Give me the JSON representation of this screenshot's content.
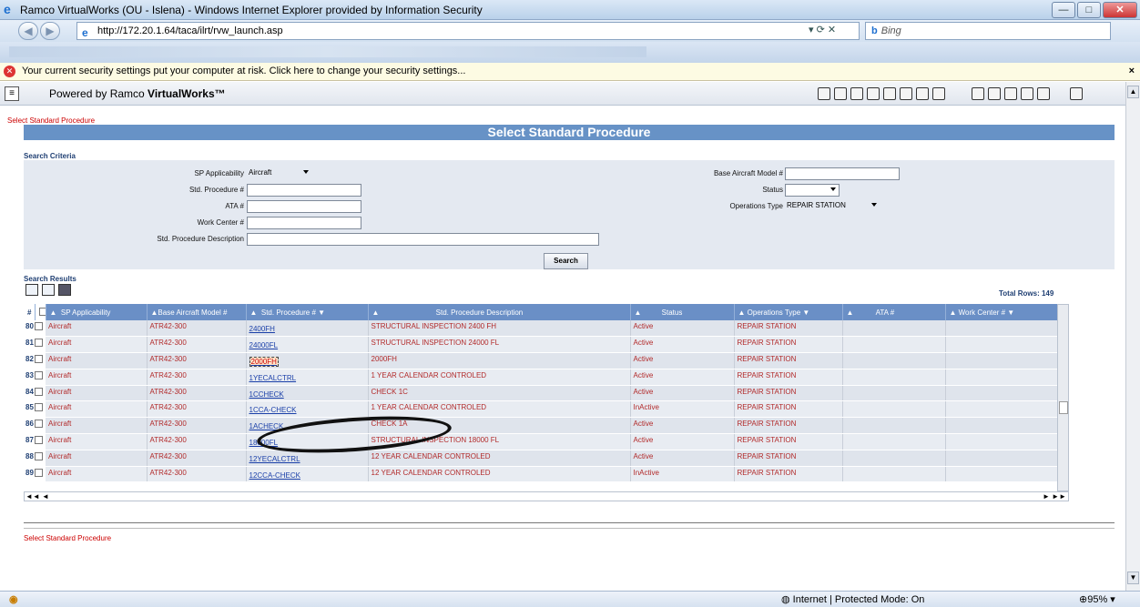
{
  "window": {
    "title": "Ramco VirtualWorks (OU - Islena) - Windows Internet Explorer provided by Information Security"
  },
  "browser": {
    "url": "http://172.20.1.64/taca/ilrt/rvw_launch.asp",
    "search_placeholder": "Bing",
    "security_message": "Your current security settings put your computer at risk. Click here to change your security settings...",
    "status_zone": "Internet | Protected Mode: On",
    "zoom": "95%"
  },
  "app": {
    "powered_by_prefix": "Powered by Ramco ",
    "powered_by_brand": "VirtualWorks™"
  },
  "page": {
    "breadcrumb": "Select Standard Procedure",
    "title": "Select Standard Procedure",
    "footer_breadcrumb": "Select Standard Procedure"
  },
  "criteria": {
    "section_label": "Search Criteria",
    "sp_applicability_label": "SP Applicability",
    "sp_applicability_value": "Aircraft",
    "std_procedure_label": "Std. Procedure #",
    "std_procedure_value": "",
    "ata_label": "ATA #",
    "ata_value": "",
    "work_center_label": "Work Center #",
    "work_center_value": "",
    "description_label": "Std. Procedure Description",
    "description_value": "",
    "base_model_label": "Base Aircraft Model #",
    "base_model_value": "",
    "status_label": "Status",
    "status_value": "",
    "ops_type_label": "Operations Type",
    "ops_type_value": "REPAIR STATION",
    "search_button": "Search"
  },
  "results": {
    "section_label": "Search Results",
    "total_rows": "Total Rows:  149",
    "columns": [
      "#",
      "SP Applicability",
      "Base Aircraft Model #",
      "Std. Procedure #",
      "Std. Procedure Description",
      "Status",
      "Operations Type",
      "ATA #",
      "Work Center #"
    ],
    "rows": [
      {
        "n": "80",
        "app": "Aircraft",
        "model": "ATR42-300",
        "proc": "2400FH",
        "desc": "STRUCTURAL INSPECTION 2400 FH",
        "status": "Active",
        "ops": "REPAIR STATION",
        "ata": "",
        "wc": ""
      },
      {
        "n": "81",
        "app": "Aircraft",
        "model": "ATR42-300",
        "proc": "24000FL",
        "desc": "STRUCTURAL INSPECTION 24000 FL",
        "status": "Active",
        "ops": "REPAIR STATION",
        "ata": "",
        "wc": ""
      },
      {
        "n": "82",
        "app": "Aircraft",
        "model": "ATR42-300",
        "proc": "2000FH",
        "desc": "2000FH",
        "status": "Active",
        "ops": "REPAIR STATION",
        "ata": "",
        "wc": ""
      },
      {
        "n": "83",
        "app": "Aircraft",
        "model": "ATR42-300",
        "proc": "1YECALCTRL",
        "desc": "1 YEAR CALENDAR CONTROLED",
        "status": "Active",
        "ops": "REPAIR STATION",
        "ata": "",
        "wc": ""
      },
      {
        "n": "84",
        "app": "Aircraft",
        "model": "ATR42-300",
        "proc": "1CCHECK",
        "desc": "CHECK 1C",
        "status": "Active",
        "ops": "REPAIR STATION",
        "ata": "",
        "wc": ""
      },
      {
        "n": "85",
        "app": "Aircraft",
        "model": "ATR42-300",
        "proc": "1CCA-CHECK",
        "desc": "1 YEAR CALENDAR CONTROLED",
        "status": "InActive",
        "ops": "REPAIR STATION",
        "ata": "",
        "wc": ""
      },
      {
        "n": "86",
        "app": "Aircraft",
        "model": "ATR42-300",
        "proc": "1ACHECK",
        "desc": "CHECK 1A",
        "status": "Active",
        "ops": "REPAIR STATION",
        "ata": "",
        "wc": ""
      },
      {
        "n": "87",
        "app": "Aircraft",
        "model": "ATR42-300",
        "proc": "18000FL",
        "desc": "STRUCTURAL INSPECTION 18000 FL",
        "status": "Active",
        "ops": "REPAIR STATION",
        "ata": "",
        "wc": ""
      },
      {
        "n": "88",
        "app": "Aircraft",
        "model": "ATR42-300",
        "proc": "12YECALCTRL",
        "desc": "12 YEAR CALENDAR CONTROLED",
        "status": "Active",
        "ops": "REPAIR STATION",
        "ata": "",
        "wc": ""
      },
      {
        "n": "89",
        "app": "Aircraft",
        "model": "ATR42-300",
        "proc": "12CCA-CHECK",
        "desc": "12 YEAR CALENDAR CONTROLED",
        "status": "InActive",
        "ops": "REPAIR STATION",
        "ata": "",
        "wc": ""
      }
    ],
    "selected_row_index": 2
  },
  "icons": [
    "ie-icon",
    "back-icon",
    "forward-icon",
    "security-warning-icon",
    "menu-icon",
    "toolbar-icons",
    "grid-tool-icons",
    "globe-icon"
  ]
}
